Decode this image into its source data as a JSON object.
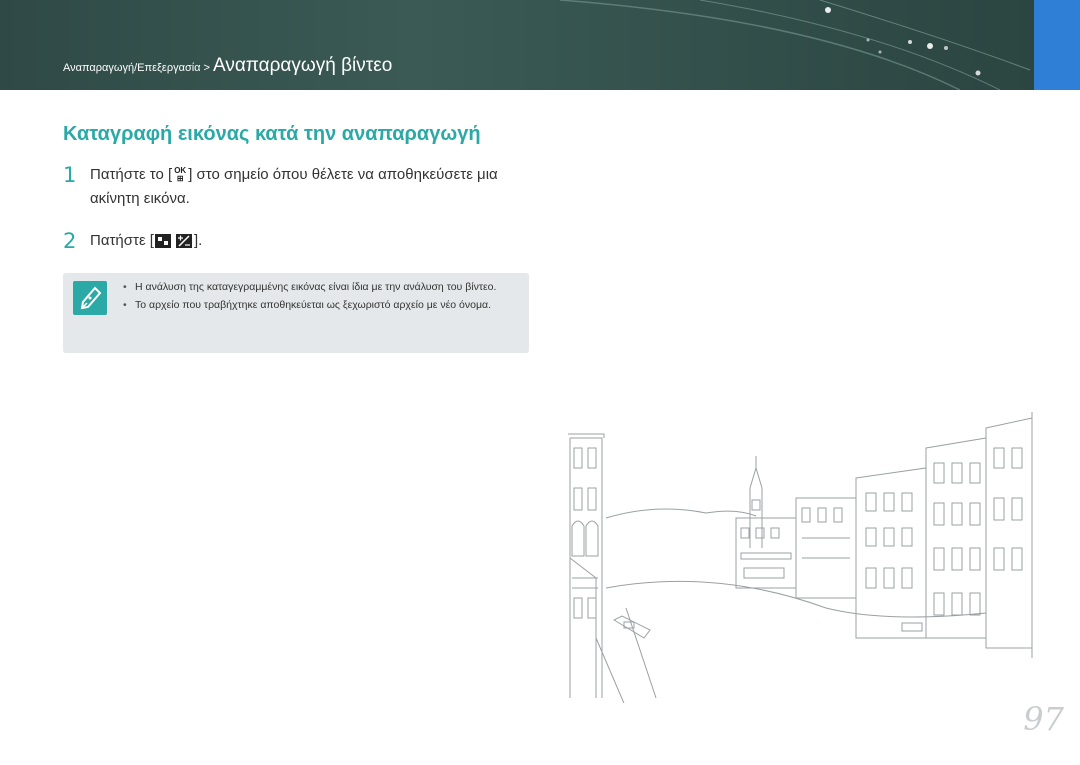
{
  "header": {
    "breadcrumb_parent": "Αναπαραγωγή/Επεξεργασία",
    "breadcrumb_separator": ">",
    "breadcrumb_current": "Αναπαραγωγή βίντεο"
  },
  "section": {
    "title": "Καταγραφή εικόνας κατά την αναπαραγωγή"
  },
  "steps": [
    {
      "number": "1",
      "text_before_icon": "Πατήστε το [",
      "icon": "ok-button-icon",
      "text_after_icon": "] στο σημείο όπου θέλετε να αποθηκεύσετε μια ακίνητη εικόνα."
    },
    {
      "number": "2",
      "text_before_icon": "Πατήστε [",
      "icon": "ev-compensation-icon",
      "text_after_icon": "]."
    }
  ],
  "note": {
    "icon": "note-pen-icon",
    "items": [
      "Η ανάλυση της καταγεγραμμένης εικόνας είναι ίδια με την ανάλυση του βίντεο.",
      "Το αρχείο που τραβήχτηκε αποθηκεύεται ως ξεχωριστό αρχείο με νέο όνομα."
    ]
  },
  "illustration": "venice-canal-line-drawing",
  "page_number": "97",
  "colors": {
    "accent": "#2aa9a6",
    "header_bg": "#3b5a55",
    "blue_tab": "#2f7fd6",
    "note_bg": "#e4e8ea"
  }
}
